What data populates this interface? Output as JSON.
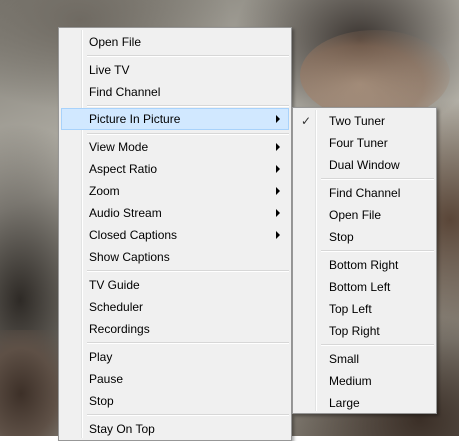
{
  "context_menu": {
    "items": [
      {
        "label": "Open File"
      },
      {
        "label": "Live TV"
      },
      {
        "label": "Find Channel"
      },
      {
        "label": "Picture In Picture",
        "submenu": true,
        "highlighted": true
      },
      {
        "label": "View Mode",
        "submenu": true
      },
      {
        "label": "Aspect Ratio",
        "submenu": true
      },
      {
        "label": "Zoom",
        "submenu": true
      },
      {
        "label": "Audio Stream",
        "submenu": true
      },
      {
        "label": "Closed Captions",
        "submenu": true
      },
      {
        "label": "Show Captions"
      },
      {
        "label": "TV Guide"
      },
      {
        "label": "Scheduler"
      },
      {
        "label": "Recordings"
      },
      {
        "label": "Play"
      },
      {
        "label": "Pause"
      },
      {
        "label": "Stop"
      },
      {
        "label": "Stay On Top"
      }
    ]
  },
  "pip_submenu": {
    "items": [
      {
        "label": "Two Tuner",
        "checked": true
      },
      {
        "label": "Four Tuner"
      },
      {
        "label": "Dual Window"
      },
      {
        "label": "Find Channel"
      },
      {
        "label": "Open File"
      },
      {
        "label": "Stop"
      },
      {
        "label": "Bottom Right"
      },
      {
        "label": "Bottom Left"
      },
      {
        "label": "Top Left"
      },
      {
        "label": "Top Right"
      },
      {
        "label": "Small"
      },
      {
        "label": "Medium"
      },
      {
        "label": "Large"
      }
    ],
    "check_glyph": "✓"
  },
  "colors": {
    "menu_background": "#f0f0f0",
    "highlight_background": "#d1e8ff",
    "highlight_border": "#a8d2fb",
    "menu_border": "#979797"
  }
}
